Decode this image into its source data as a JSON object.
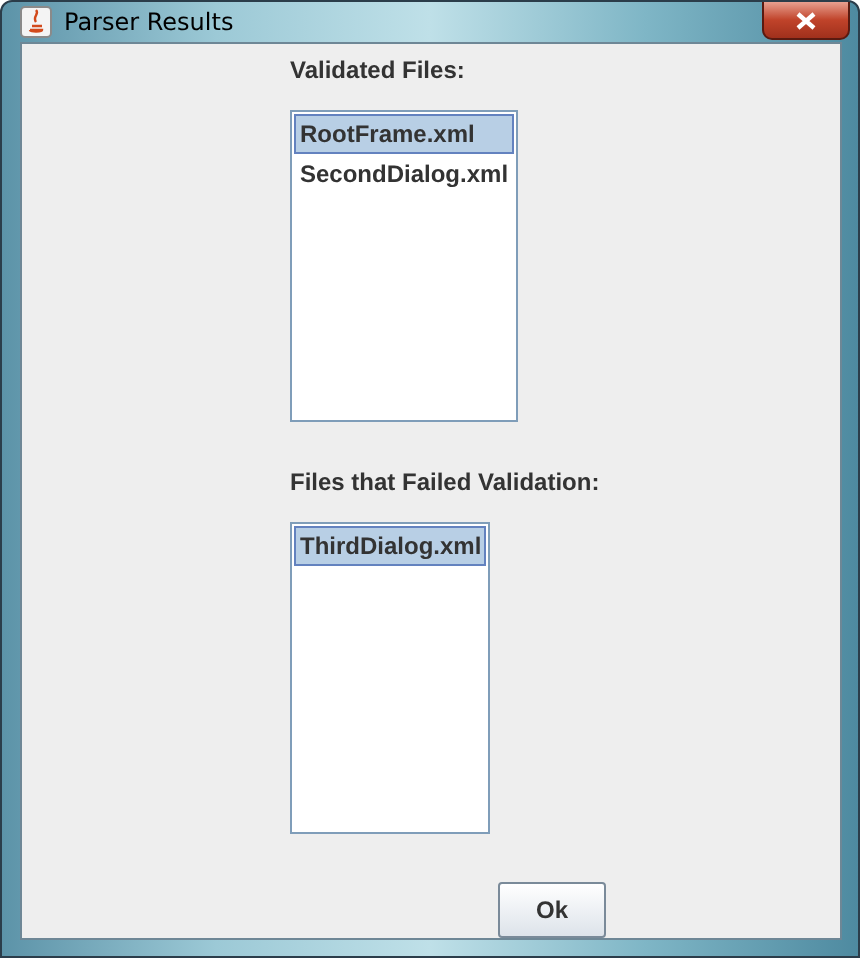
{
  "window": {
    "title": "Parser Results"
  },
  "lists": [
    {
      "label": "Validated Files:",
      "items": [
        {
          "text": "RootFrame.xml",
          "selected": true
        },
        {
          "text": "SecondDialog.xml",
          "selected": false
        }
      ]
    },
    {
      "label": "Files that Failed Validation:",
      "items": [
        {
          "text": "ThirdDialog.xml",
          "selected": true
        }
      ]
    }
  ],
  "buttons": [
    "Ok"
  ]
}
